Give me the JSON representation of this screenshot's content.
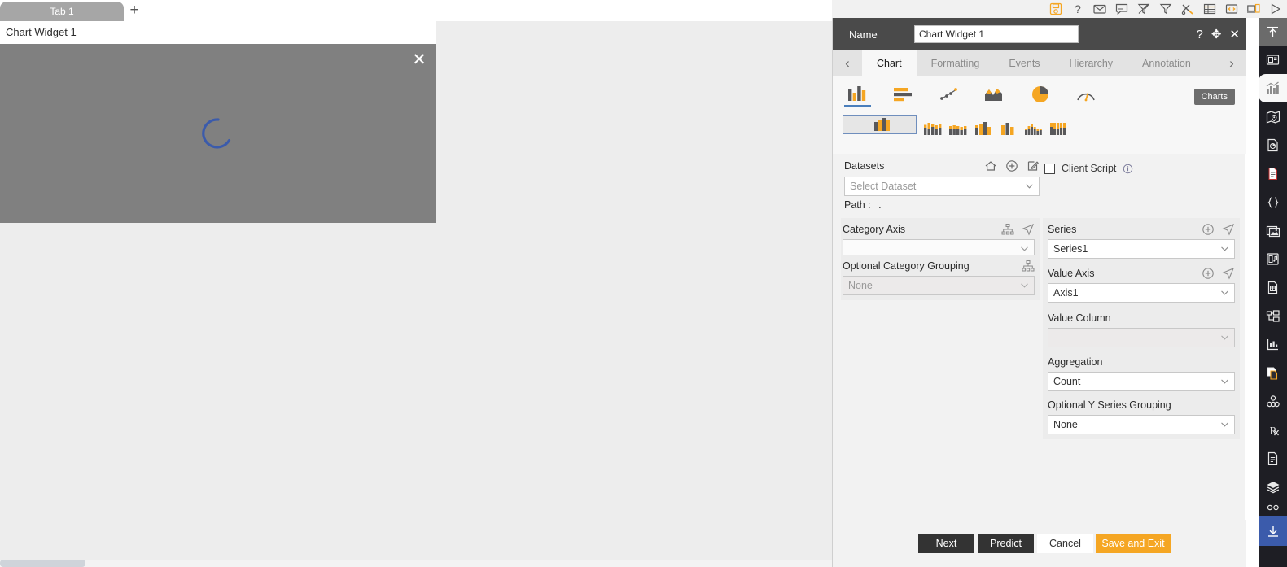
{
  "topbar": {
    "icons": [
      {
        "name": "save-disk-icon",
        "title": "Save"
      },
      {
        "name": "help-question-icon",
        "title": "Help"
      },
      {
        "name": "mail-envelope-icon",
        "title": "Mail"
      },
      {
        "name": "comment-bubble-icon",
        "title": "Comment"
      },
      {
        "name": "clear-filter-icon",
        "title": "Clear Filter"
      },
      {
        "name": "filter-funnel-icon",
        "title": "Filter"
      },
      {
        "name": "tools-icon",
        "title": "Tools"
      },
      {
        "name": "table-grid-icon",
        "title": "Table"
      },
      {
        "name": "code-window-icon",
        "title": "Code"
      },
      {
        "name": "devices-icon",
        "title": "Devices"
      },
      {
        "name": "play-run-icon",
        "title": "Run"
      }
    ]
  },
  "tabstrip": {
    "tabs": [
      {
        "label": "Tab 1"
      }
    ],
    "add_label": "+"
  },
  "widget": {
    "title": "Chart Widget 1",
    "close_label": "✕",
    "loading": true
  },
  "panel": {
    "header": {
      "name_label": "Name",
      "name_value": "Chart Widget 1",
      "help_label": "?",
      "move_label": "✥",
      "close_label": "✕"
    },
    "tabs": [
      {
        "label": "Chart",
        "active": true
      },
      {
        "label": "Formatting",
        "active": false
      },
      {
        "label": "Events",
        "active": false
      },
      {
        "label": "Hierarchy",
        "active": false
      },
      {
        "label": "Annotation",
        "active": false
      }
    ],
    "tab_prev": "‹",
    "tab_next": "›",
    "chart_families": [
      {
        "name": "bar-column-chart-icon",
        "selected": true
      },
      {
        "name": "horizontal-bar-chart-icon",
        "selected": false
      },
      {
        "name": "scatter-chart-icon",
        "selected": false
      },
      {
        "name": "area-chart-icon",
        "selected": false
      },
      {
        "name": "pie-chart-icon",
        "selected": false
      },
      {
        "name": "gauge-chart-icon",
        "selected": false
      }
    ],
    "chart_variants": [
      {
        "name": "clustered-column-icon",
        "selected": true
      },
      {
        "name": "stacked-column-icon",
        "selected": false
      },
      {
        "name": "full-stacked-column-icon",
        "selected": false
      },
      {
        "name": "column-variant-4-icon",
        "selected": false
      },
      {
        "name": "column-variant-5-icon",
        "selected": false
      },
      {
        "name": "column-variant-6-icon",
        "selected": false
      },
      {
        "name": "column-variant-7-icon",
        "selected": false
      }
    ],
    "charts_badge": "Charts",
    "datasets": {
      "label": "Datasets",
      "home_icon": "home-icon",
      "add_icon": "add-circle-icon",
      "edit_icon": "edit-pencil-icon",
      "select_placeholder": "Select Dataset",
      "select_value": "",
      "path_label": "Path :",
      "path_value": "."
    },
    "client_script": {
      "label": "Client Script",
      "checked": false,
      "info_icon": "info-circle-icon"
    },
    "category_axis": {
      "label": "Category Axis",
      "value": "",
      "hierarchy_icon": "hierarchy-icon",
      "pointer_icon": "pointer-icon"
    },
    "optional_category_grouping": {
      "label": "Optional Category Grouping",
      "value": "None",
      "hierarchy_icon": "hierarchy-icon"
    },
    "series": {
      "label": "Series",
      "value": "Series1",
      "add_icon": "add-circle-icon",
      "pointer_icon": "pointer-icon"
    },
    "value_axis": {
      "label": "Value Axis",
      "value": "Axis1",
      "add_icon": "add-circle-icon",
      "pointer_icon": "pointer-icon"
    },
    "value_column": {
      "label": "Value Column",
      "value": ""
    },
    "aggregation": {
      "label": "Aggregation",
      "value": "Count"
    },
    "optional_y_series_grouping": {
      "label": "Optional Y Series Grouping",
      "value": "None"
    },
    "footer": {
      "next": "Next",
      "predict": "Predict",
      "cancel": "Cancel",
      "save_and_exit": "Save and Exit"
    }
  },
  "rail": {
    "top_icon": "collapse-up-icon",
    "items": [
      {
        "name": "widget-panel-icon",
        "active": false
      },
      {
        "name": "chart-icon",
        "active": true
      },
      {
        "name": "map-icon",
        "active": false
      },
      {
        "name": "report-page-icon",
        "active": false
      },
      {
        "name": "document-icon",
        "active": false
      },
      {
        "name": "code-braces-icon",
        "active": false
      },
      {
        "name": "image-gallery-icon",
        "active": false
      },
      {
        "name": "media-card-icon",
        "active": false
      },
      {
        "name": "data-file-icon",
        "active": false
      },
      {
        "name": "tree-structure-icon",
        "active": false
      },
      {
        "name": "analytics-icon",
        "active": false
      },
      {
        "name": "copy-page-icon",
        "active": false
      },
      {
        "name": "cluster-icon",
        "active": false
      },
      {
        "name": "prescription-rx-icon",
        "active": false
      },
      {
        "name": "form-document-icon",
        "active": false
      },
      {
        "name": "layers-icon",
        "active": false
      },
      {
        "name": "download-icon",
        "active": true
      }
    ]
  },
  "colors": {
    "accent_amber": "#f5a623",
    "chart_gray": "#58585a",
    "panel_header": "#4a4a4a",
    "rail_bg": "#1e1e24",
    "rail_active": "#3b5bab",
    "spinner_blue": "#3b5bab",
    "widget_body": "#808080"
  }
}
